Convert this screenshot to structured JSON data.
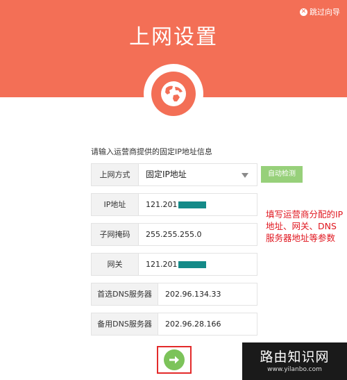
{
  "header": {
    "skip_label": "跳过向导",
    "title": "上网设置",
    "icon": "globe-icon"
  },
  "form": {
    "intro": "请输入运营商提供的固定IP地址信息",
    "connection_type_label": "上网方式",
    "connection_type_value": "固定IP地址",
    "auto_detect_label": "自动检测",
    "ip_label": "IP地址",
    "ip_value": "121.201",
    "subnet_label": "子网掩码",
    "subnet_value": "255.255.255.0",
    "gateway_label": "网关",
    "gateway_value": "121.201",
    "primary_dns_label": "首选DNS服务器",
    "primary_dns_value": "202.96.134.33",
    "secondary_dns_label": "备用DNS服务器",
    "secondary_dns_value": "202.96.28.166"
  },
  "annotation": "填写运营商分配的IP地址、网关、DNS服务器地址等参数",
  "next_icon": "arrow-right-icon",
  "watermark": {
    "title": "路由知识网",
    "url": "www.yilanbo.com"
  },
  "colors": {
    "header_bg": "#f36f56",
    "button_green": "#7cc35a",
    "annotation_red": "#e0161f"
  }
}
